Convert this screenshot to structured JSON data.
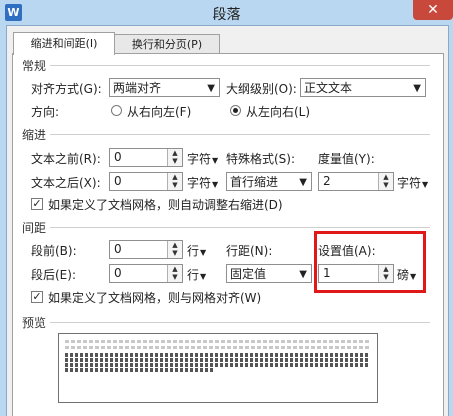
{
  "window": {
    "app_icon": "W",
    "title": "段落",
    "close": "✕"
  },
  "tabs": [
    {
      "label": "缩进和间距(I)"
    },
    {
      "label": "换行和分页(P)"
    }
  ],
  "general": {
    "title": "常规",
    "alignment_label": "对齐方式(G):",
    "alignment_value": "两端对齐",
    "outline_label": "大纲级别(O):",
    "outline_value": "正文文本",
    "direction_label": "方向:",
    "rtl_label": "从右向左(F)",
    "ltr_label": "从左向右(L)",
    "direction_selected": "ltr"
  },
  "indent": {
    "title": "缩进",
    "before_label": "文本之前(R):",
    "before_value": "0",
    "before_unit": "字符",
    "special_label": "特殊格式(S):",
    "special_value": "首行缩进",
    "measure_label": "度量值(Y):",
    "measure_value": "2",
    "measure_unit": "字符",
    "after_label": "文本之后(X):",
    "after_value": "0",
    "after_unit": "字符",
    "grid_check_label": "如果定义了文档网格，则自动调整右缩进(D)",
    "grid_checked": true
  },
  "spacing": {
    "title": "间距",
    "before_label": "段前(B):",
    "before_value": "0",
    "before_unit": "行",
    "line_label": "行距(N):",
    "line_value": "固定值",
    "setting_label": "设置值(A):",
    "setting_value": "1",
    "setting_unit": "磅",
    "after_label": "段后(E):",
    "after_value": "0",
    "after_unit": "行",
    "grid_check_label": "如果定义了文档网格，则与网格对齐(W)",
    "grid_checked": true
  },
  "preview": {
    "title": "预览"
  },
  "icons": {
    "spin_up": "▲",
    "spin_down": "▼",
    "dropdown": "▼"
  }
}
